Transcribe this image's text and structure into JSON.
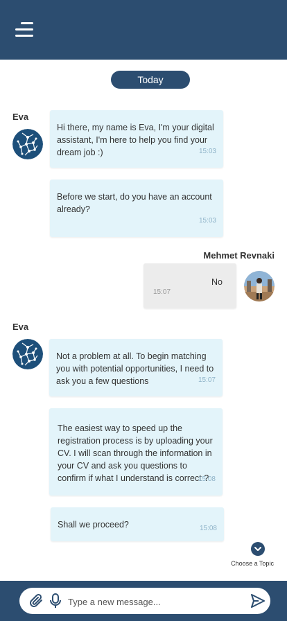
{
  "header": {
    "menu_icon": "hamburger-menu-icon"
  },
  "date_divider": "Today",
  "messages": [
    {
      "sender": "Eva",
      "text": "Hi there, my name is Eva, I'm your digital assistant, I'm here to help you find your dream job :)",
      "time": "15:03"
    },
    {
      "text": " Before we start, do you have an account already?",
      "time": "15:03"
    },
    {
      "sender": "Mehmet Revnaki",
      "text": "No",
      "time": "15:07"
    },
    {
      "sender": "Eva",
      "text": "Not a problem at all. To begin matching you with potential opportunities, I need to ask you a few questions",
      "time": "15:07"
    },
    {
      "text": "The easiest way to speed up the registration process is by uploading your CV. I will scan through the information in your CV and ask you questions to confirm if what I understand is correct ?",
      "time": "15:08"
    },
    {
      "text": "Shall we proceed?",
      "time": "15:08"
    }
  ],
  "choose_topic_label": "Choose a Topic",
  "composer": {
    "placeholder": "Type a new message..."
  },
  "colors": {
    "primary": "#2c4d70",
    "bot_bubble": "#e3f4fa",
    "user_bubble": "#ececec"
  }
}
